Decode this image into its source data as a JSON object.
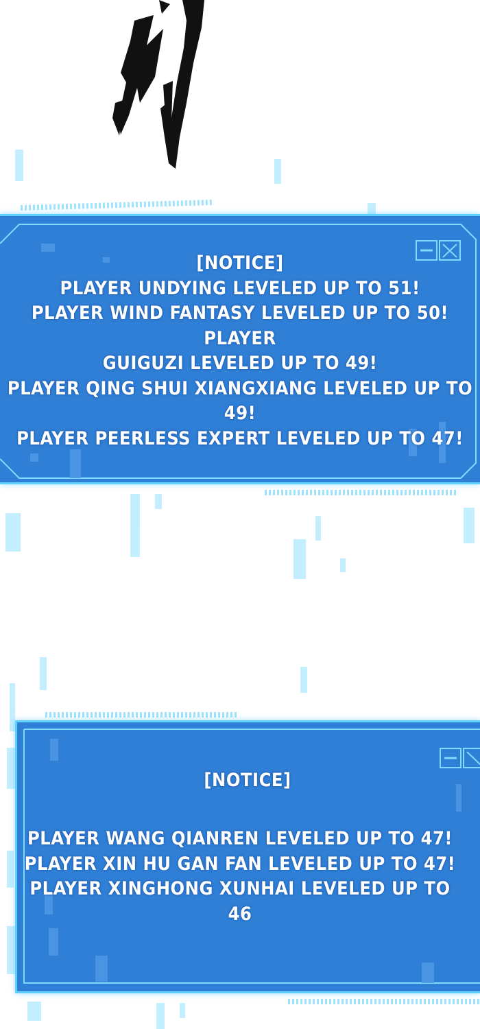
{
  "notice_1": {
    "lines": [
      "[NOTICE]",
      "PLAYER UNDYING LEVELED UP TO 51!",
      "PLAYER WIND FANTASY LEVELED UP TO 50! PLAYER",
      "GUIGUZI LEVELED UP TO 49!",
      "PLAYER QING SHUI XIANGXIANG LEVELED UP TO 49!",
      "PLAYER PEERLESS EXPERT LEVELED UP TO 47!"
    ]
  },
  "notice_2": {
    "title": "[NOTICE]",
    "lines": [
      "PLAYER WANG QIANREN LEVELED UP TO 47!",
      "PLAYER XIN HU GAN FAN LEVELED UP TO 47!",
      "PLAYER XINGHONG XUNHAI LEVELED UP TO 46"
    ]
  },
  "icons": {
    "window_buttons": "minimize-close-icon",
    "brush_mark": "ink-brush-stroke"
  },
  "colors": {
    "panel_fill": "#2f7fd6",
    "panel_border": "#5fd0ff",
    "glitch": "#b9ecff"
  }
}
